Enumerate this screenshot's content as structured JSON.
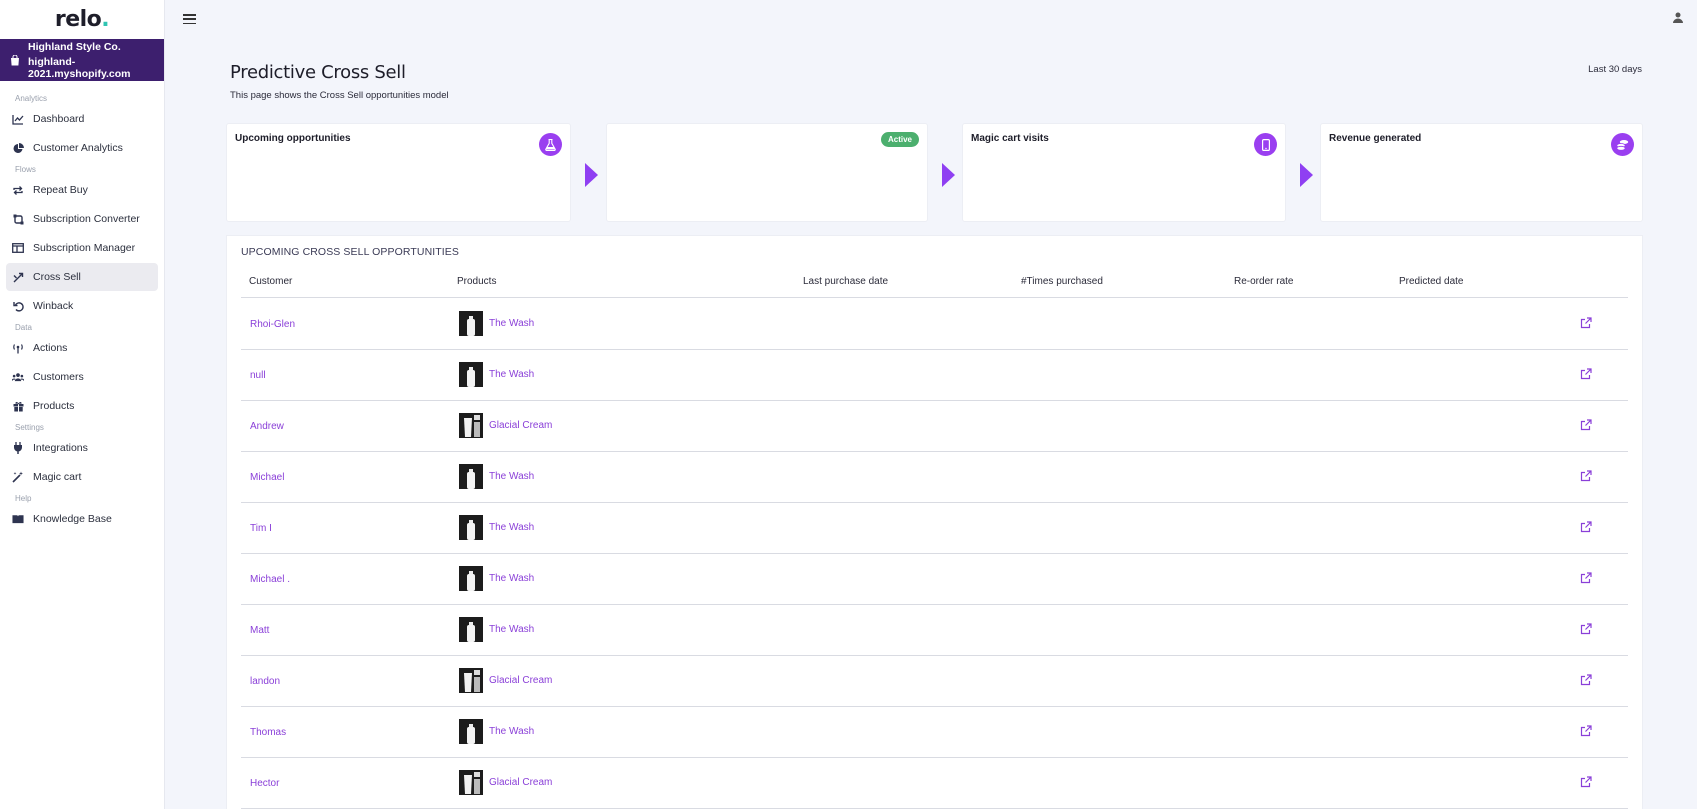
{
  "app": {
    "logo_text": "relo",
    "logo_dot": ".",
    "store_name": "Highland Style Co.",
    "store_domain": "highland-2021.myshopify.com"
  },
  "sidebar": {
    "sections": {
      "analytics": "Analytics",
      "flows": "Flows",
      "data": "Data",
      "settings": "Settings",
      "help": "Help"
    },
    "items": {
      "dashboard": "Dashboard",
      "customer_analytics": "Customer Analytics",
      "repeat_buy": "Repeat Buy",
      "subscription_converter": "Subscription Converter",
      "subscription_manager": "Subscription Manager",
      "cross_sell": "Cross Sell",
      "winback": "Winback",
      "actions": "Actions",
      "customers": "Customers",
      "products": "Products",
      "integrations": "Integrations",
      "magic_cart": "Magic cart",
      "knowledge_base": "Knowledge Base"
    },
    "active": "cross_sell"
  },
  "page": {
    "title": "Predictive Cross Sell",
    "subtitle": "This page shows the Cross Sell opportunities model",
    "date_range": "Last 30 days"
  },
  "cards": {
    "upcoming": {
      "title": "Upcoming opportunities",
      "icon": "flask-icon"
    },
    "status": {
      "badge": "Active"
    },
    "magic_cart": {
      "title": "Magic cart visits",
      "icon": "mobile-icon"
    },
    "revenue": {
      "title": "Revenue generated",
      "icon": "coins-icon"
    }
  },
  "table": {
    "title": "UPCOMING CROSS SELL OPPORTUNITIES",
    "columns": {
      "customer": "Customer",
      "products": "Products",
      "last_purchase": "Last purchase date",
      "times": "#Times purchased",
      "reorder": "Re-order rate",
      "predicted": "Predicted date"
    },
    "rows": [
      {
        "customer": "Rhoi-Glen",
        "product": "The Wash"
      },
      {
        "customer": "null",
        "product": "The Wash"
      },
      {
        "customer": "Andrew",
        "product": "Glacial Cream"
      },
      {
        "customer": "Michael",
        "product": "The Wash"
      },
      {
        "customer": "Tim I",
        "product": "The Wash"
      },
      {
        "customer": "Michael .",
        "product": "The Wash"
      },
      {
        "customer": "Matt",
        "product": "The Wash"
      },
      {
        "customer": "landon",
        "product": "Glacial Cream"
      },
      {
        "customer": "Thomas",
        "product": "The Wash"
      },
      {
        "customer": "Hector",
        "product": "Glacial Cream"
      }
    ]
  },
  "colors": {
    "brand_purple": "#9a3ff0",
    "store_bar": "#3d1f6e",
    "link": "#8a3fd8",
    "active_badge": "#4caf6e"
  }
}
